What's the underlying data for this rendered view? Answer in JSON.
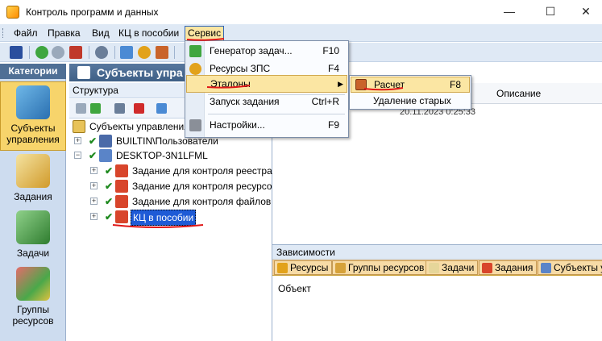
{
  "window": {
    "title": "Контроль программ и данных",
    "minimize": "—",
    "maximize": "☐",
    "close": "✕"
  },
  "menubar": {
    "items": [
      "Файл",
      "Правка",
      "Вид",
      "КЦ в пособии",
      "Сервис"
    ]
  },
  "categories": {
    "header": "Категории",
    "items": [
      "Субъекты управления",
      "Задания",
      "Задачи",
      "Группы ресурсов"
    ]
  },
  "subjects": {
    "header": "Субъекты упра",
    "structure": "Структура"
  },
  "tree": {
    "root": "Субъекты управления",
    "nodes": [
      "BUILTIN\\Пользователи",
      "DESKTOP-3N1LFML",
      "Задание для контроля реестра",
      "Задание для контроля ресурсо",
      "Задание для контроля файлов",
      "КЦ в пособии"
    ]
  },
  "grid": {
    "description_col": "Описание",
    "timestamp": "20.11.2023 0:25:33"
  },
  "dependencies": {
    "title": "Зависимости",
    "tabs": [
      "Ресурсы",
      "Группы ресурсов",
      "Задачи",
      "Задания",
      "Субъекты у"
    ],
    "column": "Объект"
  },
  "service_menu": {
    "items": [
      {
        "label": "Генератор задач...",
        "key": "F10"
      },
      {
        "label": "Ресурсы ЗПС",
        "key": "F4"
      },
      {
        "label": "Эталоны",
        "key": ""
      },
      {
        "label": "Запуск задания",
        "key": "Ctrl+R"
      },
      {
        "label": "Настройки...",
        "key": "F9"
      }
    ]
  },
  "etalon_submenu": {
    "items": [
      {
        "label": "Расчет",
        "key": "F8"
      },
      {
        "label": "Удаление старых",
        "key": ""
      }
    ]
  },
  "colors": {
    "accent": "#2f64b8",
    "highlight": "#fbe6a3",
    "annotation": "#e01818",
    "selection": "#1e5bd6"
  }
}
